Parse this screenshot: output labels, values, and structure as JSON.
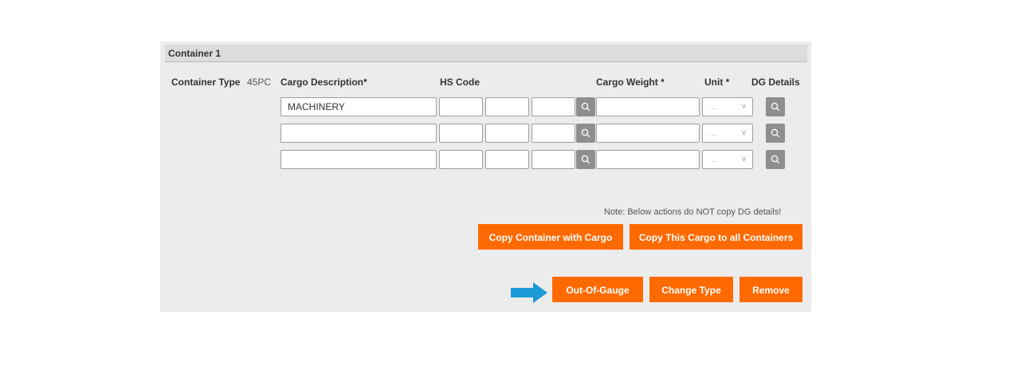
{
  "container": {
    "title": "Container 1",
    "type_label": "Container Type",
    "type_value": "45PC"
  },
  "columns": {
    "cargo_description": "Cargo Description*",
    "hs_code": "HS Code",
    "cargo_weight": "Cargo Weight *",
    "unit": "Unit *",
    "dg_details": "DG Details"
  },
  "rows": [
    {
      "description": "MACHINERY",
      "hs1": "",
      "hs2": "",
      "hs3": "",
      "weight": "",
      "unit": "..."
    },
    {
      "description": "",
      "hs1": "",
      "hs2": "",
      "hs3": "",
      "weight": "",
      "unit": "..."
    },
    {
      "description": "",
      "hs1": "",
      "hs2": "",
      "hs3": "",
      "weight": "",
      "unit": "..."
    }
  ],
  "note": "Note: Below actions do NOT copy DG details!",
  "buttons": {
    "copy_container": "Copy Container with Cargo",
    "copy_cargo_all": "Copy This Cargo to all Containers",
    "out_of_gauge": "Out-Of-Gauge",
    "change_type": "Change Type",
    "remove": "Remove"
  },
  "colors": {
    "accent": "#ff6a00",
    "arrow": "#1a9ad6",
    "panel": "#ececec",
    "search_button": "#8e8e8e"
  }
}
